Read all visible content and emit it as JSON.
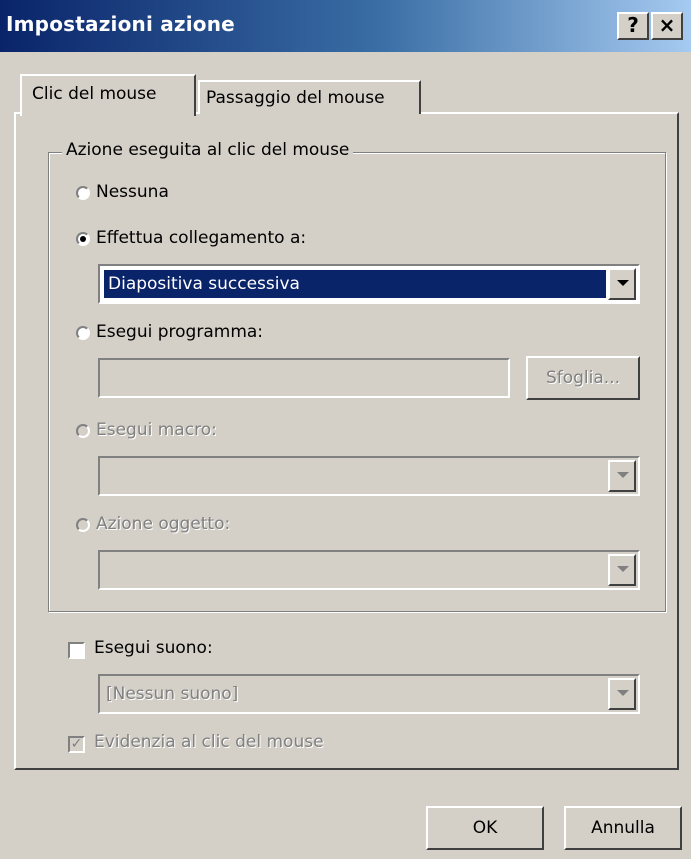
{
  "window": {
    "title": "Impostazioni azione",
    "help_label": "?",
    "close_label": "×"
  },
  "tabs": [
    {
      "label": "Clic del mouse",
      "selected": true
    },
    {
      "label": "Passaggio del mouse",
      "selected": false
    }
  ],
  "group": {
    "legend": "Azione eseguita al clic del mouse"
  },
  "options": {
    "nessuna": "Nessuna",
    "collegamento": "Effettua collegamento a:",
    "collegamento_value": "Diapositiva successiva",
    "programma": "Esegui programma:",
    "programma_value": "",
    "sfoglia": "Sfoglia...",
    "macro": "Esegui macro:",
    "macro_value": "",
    "oggetto": "Azione oggetto:",
    "oggetto_value": ""
  },
  "sound": {
    "label": "Esegui suono:",
    "value": "[Nessun suono]",
    "checked": false
  },
  "highlight": {
    "label": "Evidenzia al clic del mouse",
    "checked": true
  },
  "buttons": {
    "ok": "OK",
    "cancel": "Annulla"
  },
  "colors": {
    "title_start": "#0a246a",
    "title_end": "#a6caf0",
    "face": "#d4d0c8",
    "selection": "#0a246a"
  }
}
